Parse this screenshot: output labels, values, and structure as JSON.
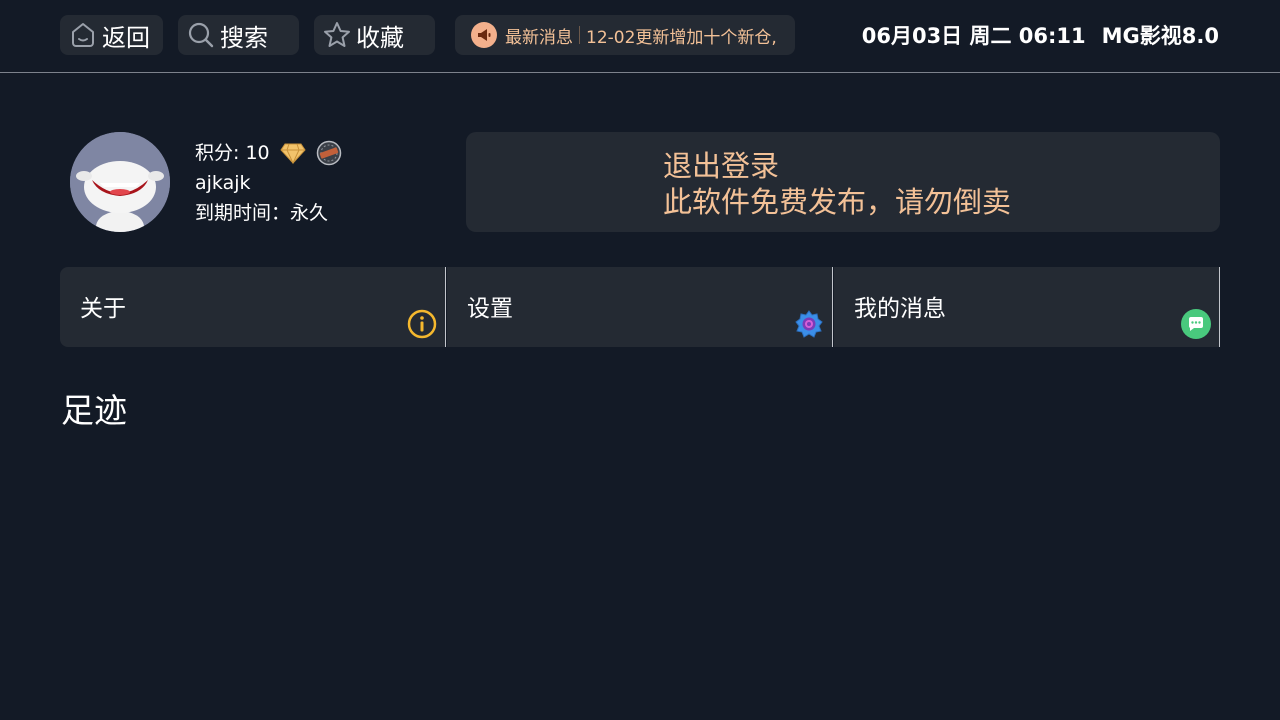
{
  "topbar": {
    "back_label": "返回",
    "search_label": "搜索",
    "favorites_label": "收藏",
    "news_label": "最新消息",
    "news_text": "12-02更新增加十个新仓,",
    "date_time": "06月03日 周二 06:11",
    "app_name": "MG影视8.0"
  },
  "user": {
    "points": "积分: 10",
    "username": "ajkajk",
    "expiry_label": "到期时间：",
    "expiry_value": "永久"
  },
  "notice": {
    "line1": "退出登录",
    "line2": "此软件免费发布，请勿倒卖"
  },
  "cards": [
    {
      "label": "关于",
      "icon": "info-icon",
      "color": "#f5b82e"
    },
    {
      "label": "设置",
      "icon": "gear-icon",
      "color": "#2e7fe0"
    },
    {
      "label": "我的消息",
      "icon": "chat-icon",
      "color": "#49c97d"
    }
  ],
  "section": {
    "title": "足迹"
  },
  "colors": {
    "background": "#131a26",
    "panel": "#242a33",
    "accent_text": "#f3c197"
  }
}
